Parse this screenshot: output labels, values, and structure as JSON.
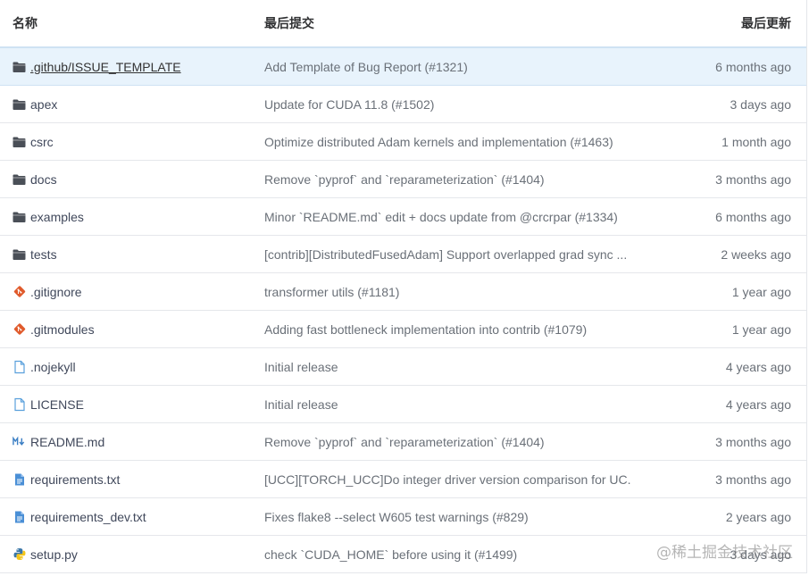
{
  "header": {
    "name": "名称",
    "last_commit": "最后提交",
    "last_updated": "最后更新"
  },
  "rows": [
    {
      "icon": "folder-icon",
      "name": ".github/ISSUE_TEMPLATE",
      "commit": "Add Template of Bug Report (#1321)",
      "updated": "6 months ago"
    },
    {
      "icon": "folder-icon",
      "name": "apex",
      "commit": "Update for CUDA 11.8 (#1502)",
      "updated": "3 days ago"
    },
    {
      "icon": "folder-icon",
      "name": "csrc",
      "commit": "Optimize distributed Adam kernels and implementation (#1463)",
      "updated": "1 month ago"
    },
    {
      "icon": "folder-icon",
      "name": "docs",
      "commit": "Remove `pyprof` and `reparameterization` (#1404)",
      "updated": "3 months ago"
    },
    {
      "icon": "folder-icon",
      "name": "examples",
      "commit": "Minor `README.md` edit + docs update from @crcrpar (#1334)",
      "updated": "6 months ago"
    },
    {
      "icon": "folder-icon",
      "name": "tests",
      "commit": "[contrib][DistributedFusedAdam] Support overlapped grad sync ...",
      "updated": "2 weeks ago"
    },
    {
      "icon": "git-icon",
      "name": ".gitignore",
      "commit": "transformer utils (#1181)",
      "updated": "1 year ago"
    },
    {
      "icon": "git-icon",
      "name": ".gitmodules",
      "commit": "Adding fast bottleneck implementation into contrib (#1079)",
      "updated": "1 year ago"
    },
    {
      "icon": "file-icon",
      "name": ".nojekyll",
      "commit": "Initial release",
      "updated": "4 years ago"
    },
    {
      "icon": "file-icon",
      "name": "LICENSE",
      "commit": "Initial release",
      "updated": "4 years ago"
    },
    {
      "icon": "markdown-icon",
      "name": "README.md",
      "commit": "Remove `pyprof` and `reparameterization` (#1404)",
      "updated": "3 months ago"
    },
    {
      "icon": "text-file-icon",
      "name": "requirements.txt",
      "commit": "[UCC][TORCH_UCC]Do integer driver version comparison for UC...",
      "updated": "3 months ago"
    },
    {
      "icon": "text-file-icon",
      "name": "requirements_dev.txt",
      "commit": "Fixes flake8 --select W605 test warnings (#829)",
      "updated": "2 years ago"
    },
    {
      "icon": "python-icon",
      "name": "setup.py",
      "commit": "check `CUDA_HOME` before using it (#1499)",
      "updated": "3 days ago"
    }
  ],
  "watermark": "@稀土掘金技术社区",
  "colors": {
    "selected_row_bg": "#e8f3fc",
    "folder": "#4a4f57",
    "git": "#e05a2b",
    "file": "#5aa0dc",
    "python_blue": "#3b77a8",
    "python_yellow": "#f5c518"
  }
}
